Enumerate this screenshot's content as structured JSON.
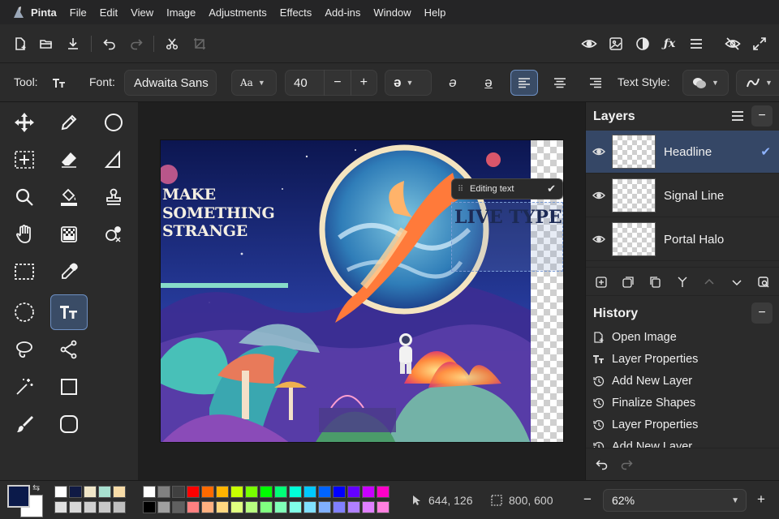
{
  "app": {
    "name": "Pinta",
    "menu": [
      "File",
      "Edit",
      "View",
      "Image",
      "Adjustments",
      "Effects",
      "Add-ins",
      "Window",
      "Help"
    ]
  },
  "toolbar": {
    "left_icons": [
      "new-image-icon",
      "open-icon",
      "save-icon",
      "undo-icon",
      "redo-icon",
      "cut-icon",
      "crop-icon"
    ],
    "right_icons": [
      "eye-icon",
      "image-icon",
      "contrast-icon",
      "effects-fx-icon",
      "menu-icon",
      "hide-icon",
      "fullscreen-icon"
    ]
  },
  "tool_settings": {
    "tool_label": "Tool:",
    "font_label": "Font:",
    "font_name": "Adwaita Sans",
    "font_size": "40",
    "minus": "−",
    "plus": "+",
    "style_label": "Text Style:",
    "active_alignment": "left"
  },
  "tools": {
    "active": "text",
    "items": [
      "move-selected",
      "pencil",
      "ellipse",
      "move-selection",
      "eraser",
      "freeform-shape",
      "zoom",
      "paint-bucket",
      "clone-stamp",
      "pan",
      "gradient",
      "recolor",
      "rectangle-select",
      "color-picker",
      "text",
      "ellipse-select",
      "line-curve",
      "lasso-select",
      "rectangle",
      "magic-wand",
      "rounded-rectangle",
      "paintbrush"
    ]
  },
  "canvas": {
    "headline_lines": [
      "MAKE",
      "SOMETHING",
      "STRANGE"
    ],
    "editing_text": "LIVE TYPE",
    "popover_label": "Editing text",
    "accent_color": "#87dbc9"
  },
  "layers": {
    "title": "Layers",
    "items": [
      {
        "name": "Headline",
        "selected": true
      },
      {
        "name": "Signal Line",
        "selected": false
      },
      {
        "name": "Portal Halo",
        "selected": false
      }
    ]
  },
  "history": {
    "title": "History",
    "items": [
      {
        "label": "Open Image",
        "icon": "new-image-icon"
      },
      {
        "label": "Layer Properties",
        "icon": "text-tool-icon"
      },
      {
        "label": "Add New Layer",
        "icon": "history-icon"
      },
      {
        "label": "Finalize Shapes",
        "icon": "history-icon"
      },
      {
        "label": "Layer Properties",
        "icon": "history-icon"
      },
      {
        "label": "Add New Layer",
        "icon": "history-icon"
      }
    ]
  },
  "status": {
    "cursor": "644, 126",
    "selection_size": "800, 600",
    "zoom": "62%",
    "zoom_minus": "−",
    "zoom_plus": "+",
    "primary_color": "#0b1a4a",
    "secondary_color": "#ffffff",
    "palette_recent": [
      [
        "#ffffff",
        "#101a44",
        "#f0e6c8",
        "#a8e0d0",
        "#f8dca8"
      ],
      [
        "#e0e0e0",
        "#d8d8d8",
        "#d0d0d0",
        "#c8c8c8",
        "#c0c0c0"
      ]
    ],
    "palette_main_top": [
      "#ffffff",
      "#808080",
      "#404040",
      "#ff0000",
      "#ff6a00",
      "#ffb400",
      "#c8ff00",
      "#78ff00",
      "#00ff00",
      "#00ff78",
      "#00ffd8",
      "#00c8ff",
      "#0064ff",
      "#0000ff",
      "#6400ff",
      "#c800ff",
      "#ff00c8"
    ],
    "palette_main_bottom": [
      "#000000",
      "#a0a0a0",
      "#606060",
      "#ff8080",
      "#ffb080",
      "#ffd880",
      "#e0ff80",
      "#b8ff80",
      "#80ff80",
      "#80ffb8",
      "#80ffe8",
      "#80e0ff",
      "#80b0ff",
      "#8080ff",
      "#b080ff",
      "#e080ff",
      "#ff80e0"
    ]
  }
}
